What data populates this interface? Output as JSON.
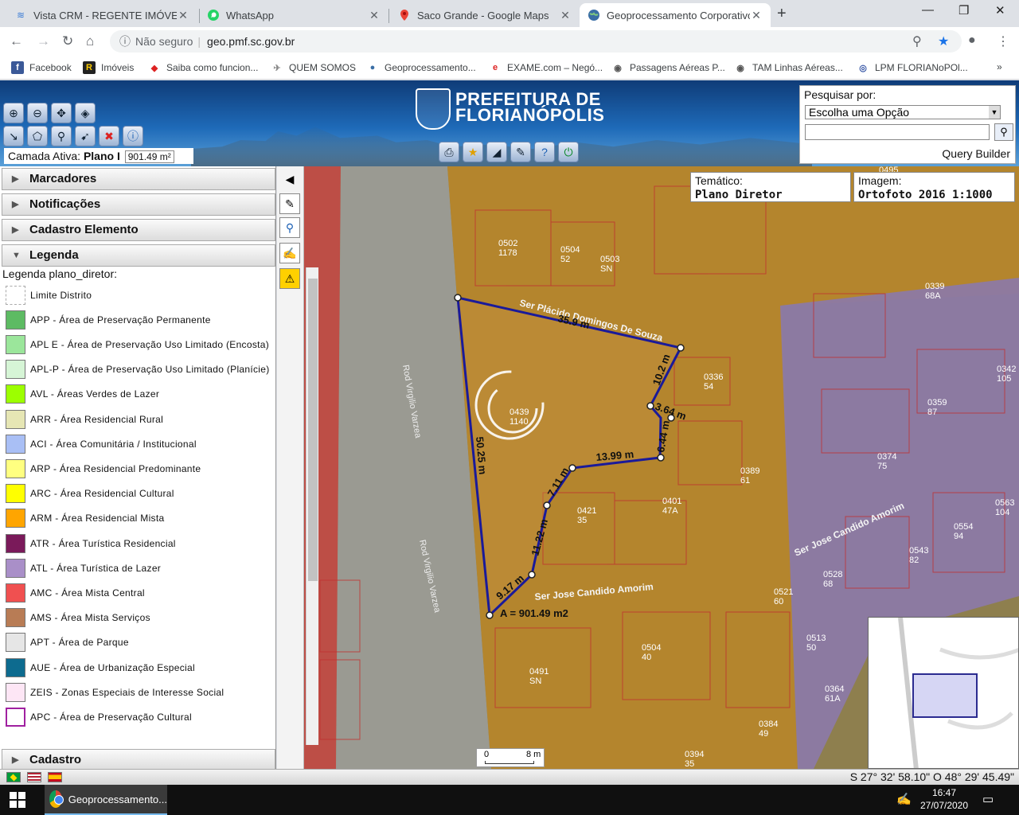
{
  "browser": {
    "tabs": [
      {
        "title": "Vista CRM - REGENTE IMÓVEIS",
        "icon": "vista-crm-icon"
      },
      {
        "title": "WhatsApp",
        "icon": "whatsapp-icon"
      },
      {
        "title": "Saco Grande - Google Maps",
        "icon": "google-maps-icon"
      },
      {
        "title": "Geoprocessamento Corporativo",
        "icon": "globe-icon",
        "active": true
      }
    ],
    "security_label": "Não seguro",
    "url": "geo.pmf.sc.gov.br",
    "bookmarks": [
      {
        "label": "Facebook",
        "icon": "facebook-icon"
      },
      {
        "label": "Imóveis",
        "icon": "imoveis-icon"
      },
      {
        "label": "Saiba como funcion...",
        "icon": "diamond-icon"
      },
      {
        "label": "QUEM SOMOS",
        "icon": "plane-icon"
      },
      {
        "label": "Geoprocessamento...",
        "icon": "globe-icon"
      },
      {
        "label": "EXAME.com – Negó...",
        "icon": "exame-icon"
      },
      {
        "label": "Passagens Aéreas P...",
        "icon": "globe-icon"
      },
      {
        "label": "TAM Linhas Aéreas...",
        "icon": "globe-icon"
      },
      {
        "label": "LPM FLORIANoPOl...",
        "icon": "lpm-icon"
      }
    ],
    "more_bookmarks": "»"
  },
  "header": {
    "logo_line1": "PREFEITURA DE",
    "logo_line2": "FLORIANÓPOLIS",
    "camada_label": "Camada Ativa:",
    "camada_value": "Plano I",
    "camada_area": "901.49 m²"
  },
  "search": {
    "title": "Pesquisar por:",
    "select_value": "Escolha uma Opção",
    "input_value": "",
    "query_builder": "Query Builder"
  },
  "sidebar": {
    "sections": [
      "Marcadores",
      "Notificações",
      "Cadastro Elemento",
      "Legenda"
    ],
    "bottom_section": "Cadastro",
    "legend_title": "Legenda plano_diretor:",
    "legend": [
      {
        "label": "Limite Distrito",
        "color": "#ffffff"
      },
      {
        "label": "APP - Área de Preservação Permanente",
        "color": "#5dbb63"
      },
      {
        "label": "APL E - Área de Preservação Uso Limitado (Encosta)",
        "color": "#9be69b"
      },
      {
        "label": "APL-P - Área de Preservação Uso Limitado (Planície)",
        "color": "#d6f5d6"
      },
      {
        "label": "AVL - Áreas Verdes de Lazer",
        "color": "#9cff00"
      },
      {
        "label": "ARR - Área Residencial Rural",
        "color": "#e6e6b4"
      },
      {
        "label": "ACI - Área Comunitária / Institucional",
        "color": "#a9bff5"
      },
      {
        "label": "ARP - Área Residencial Predominante",
        "color": "#ffff80"
      },
      {
        "label": "ARC - Área Residencial Cultural",
        "color": "#ffff00"
      },
      {
        "label": "ARM - Área Residencial Mista",
        "color": "#ffa500"
      },
      {
        "label": "ATR - Área Turística Residencial",
        "color": "#7a1a5a"
      },
      {
        "label": "ATL - Área Turística de Lazer",
        "color": "#a98fc8"
      },
      {
        "label": "AMC - Área Mista Central",
        "color": "#f05050"
      },
      {
        "label": "AMS - Área Mista Serviços",
        "color": "#b87c55"
      },
      {
        "label": "APT - Área de Parque",
        "color": "#e6e6e6"
      },
      {
        "label": "AUE - Área de Urbanização Especial",
        "color": "#0d6b8f"
      },
      {
        "label": "ZEIS - Zonas Especiais de Interesse Social",
        "color": "#fde6f5"
      },
      {
        "label": "APC - Área de Preservação Cultural",
        "color": "#ffffff"
      }
    ]
  },
  "map": {
    "tematico_label": "Temático:",
    "tematico_value": "Plano Diretor",
    "imagem_label": "Imagem:",
    "imagem_value": "Ortofoto 2016 1:1000",
    "streets": [
      "Rod Virgilio Varzea",
      "Rod Virgilio Varzea",
      "Ser Plácido Domingos De Souza",
      "Ser Jose Candido Amorim",
      "Ser Jose Candido Amorim"
    ],
    "measures": [
      "35.9 m",
      "10.2 m",
      "3.64 m",
      "6.44 m",
      "13.99 m",
      "7.11 m",
      "11.22 m",
      "9.17 m",
      "50.25 m"
    ],
    "area_label": "A = 901.49 m2",
    "lots": [
      [
        "0502",
        "1178"
      ],
      [
        "0504",
        "52"
      ],
      [
        "0503",
        "SN"
      ],
      [
        "0339",
        "68A"
      ],
      [
        "0336",
        "54"
      ],
      [
        "0342",
        "105"
      ],
      [
        "0359",
        "87"
      ],
      [
        "0374",
        "75"
      ],
      [
        "0389",
        "61"
      ],
      [
        "0401",
        "47A"
      ],
      [
        "0421",
        "35"
      ],
      [
        "0439",
        "1140"
      ],
      [
        "0563",
        "104"
      ],
      [
        "0554",
        "94"
      ],
      [
        "0543",
        "82"
      ],
      [
        "0528",
        "68"
      ],
      [
        "0521",
        "60"
      ],
      [
        "0513",
        "50"
      ],
      [
        "0504",
        "40"
      ],
      [
        "0491",
        "SN"
      ],
      [
        "0384",
        "49"
      ],
      [
        "0394",
        "35"
      ],
      [
        "0364",
        "61A"
      ],
      [
        "0495",
        ""
      ]
    ],
    "scale_zero": "0",
    "scale_end": "8 m"
  },
  "statusbar": {
    "coords": "S 27° 32' 58.10\" O 48° 29' 45.49\""
  },
  "taskbar": {
    "app_label": "Geoprocessamento...",
    "time": "16:47",
    "date": "27/07/2020"
  }
}
